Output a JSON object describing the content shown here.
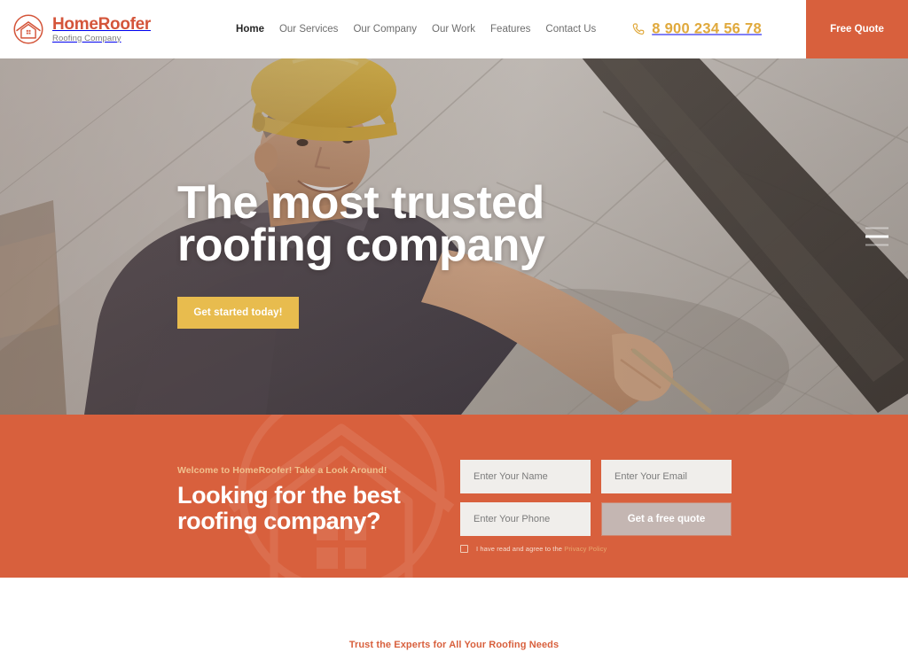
{
  "header": {
    "brand": {
      "name": "HomeRoofer",
      "tagline": "Roofing Company",
      "logo_icon": "house-in-circle-icon",
      "color": "#D4553A"
    },
    "nav": [
      {
        "label": "Home",
        "active": true
      },
      {
        "label": "Our Services",
        "active": false
      },
      {
        "label": "Our Company",
        "active": false
      },
      {
        "label": "Our Work",
        "active": false
      },
      {
        "label": "Features",
        "active": false
      },
      {
        "label": "Contact Us",
        "active": false
      }
    ],
    "phone": {
      "icon": "phone-icon",
      "number": "8 900 234 56 78",
      "color": "#E0A93C"
    },
    "cta_button": {
      "label": "Free Quote",
      "background": "#D8603D"
    }
  },
  "hero": {
    "title": "The most trusted roofing company",
    "button_label": "Get started today!",
    "button_color": "#E8BC4E",
    "slider_icon": "slider-lines-icon",
    "image_description": "Roofer in a yellow hard hat smiling while working on a grey shingle roof"
  },
  "cta": {
    "background": "#D8603D",
    "eyebrow": "Welcome to HomeRoofer! Take a Look Around!",
    "title": "Looking for the best roofing company?",
    "watermark_icon": "house-roof-watermark-icon",
    "form": {
      "name_placeholder": "Enter Your Name",
      "email_placeholder": "Enter Your Email",
      "phone_placeholder": "Enter Your Phone",
      "name_value": "",
      "email_value": "",
      "phone_value": "",
      "submit_label": "Get a free quote",
      "submit_color": "#C4B6B2",
      "consent_text": "I have read and agree to the",
      "consent_link": "Privacy Policy",
      "consent_checked": false
    }
  },
  "bottom": {
    "eyebrow": "Trust the Experts for All Your Roofing Needs",
    "color": "#D8603D"
  }
}
